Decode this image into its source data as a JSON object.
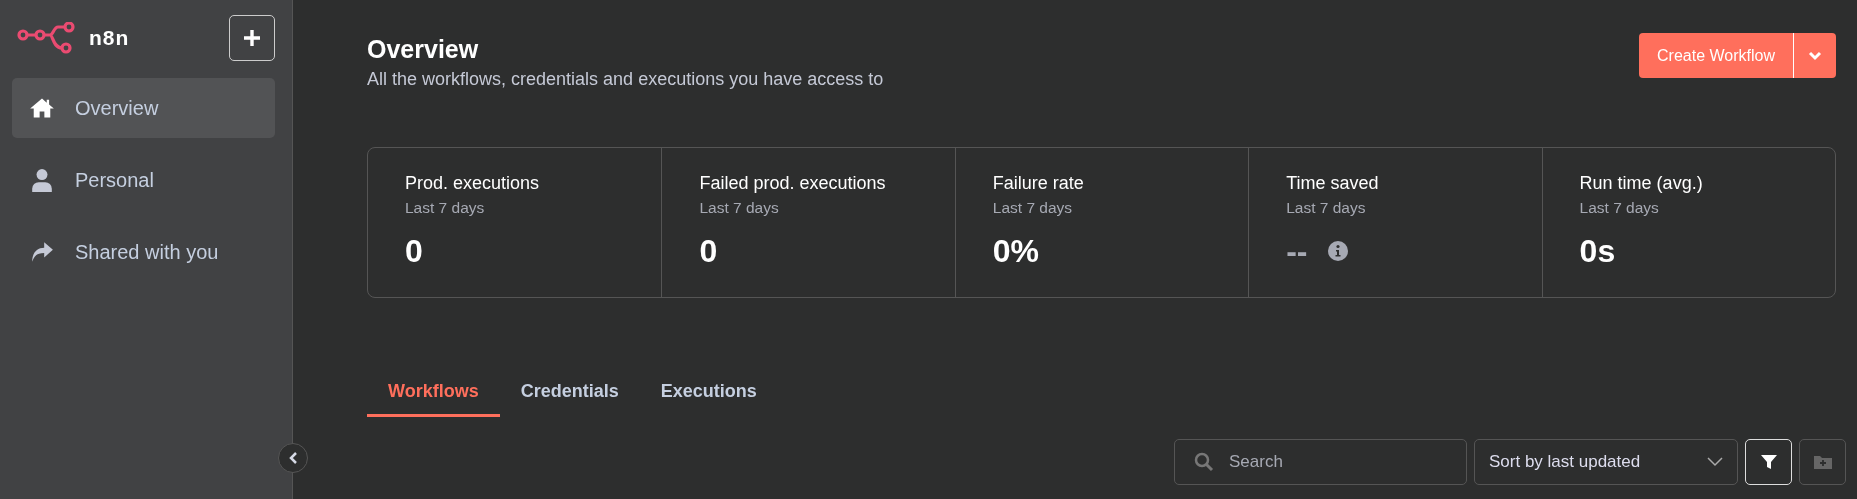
{
  "sidebar": {
    "logo_text": "n8n",
    "items": [
      {
        "label": "Overview",
        "selected": true
      },
      {
        "label": "Personal",
        "selected": false
      },
      {
        "label": "Shared with you",
        "selected": false
      }
    ]
  },
  "header": {
    "title": "Overview",
    "subtitle": "All the workflows, credentials and executions you have access to",
    "create_button": "Create Workflow"
  },
  "stats": [
    {
      "title": "Prod. executions",
      "period": "Last 7 days",
      "value": "0",
      "muted": false,
      "info": false
    },
    {
      "title": "Failed prod. executions",
      "period": "Last 7 days",
      "value": "0",
      "muted": false,
      "info": false
    },
    {
      "title": "Failure rate",
      "period": "Last 7 days",
      "value": "0%",
      "muted": false,
      "info": false
    },
    {
      "title": "Time saved",
      "period": "Last 7 days",
      "value": "--",
      "muted": true,
      "info": true
    },
    {
      "title": "Run time (avg.)",
      "period": "Last 7 days",
      "value": "0s",
      "muted": false,
      "info": false
    }
  ],
  "tabs": [
    {
      "label": "Workflows",
      "selected": true
    },
    {
      "label": "Credentials",
      "selected": false
    },
    {
      "label": "Executions",
      "selected": false
    }
  ],
  "toolbar": {
    "search": {
      "placeholder": "Search"
    },
    "sort": {
      "value": "Sort by last updated"
    },
    "icon_buttons": [
      {
        "kind": "filter",
        "disabled": false
      },
      {
        "kind": "new-folder",
        "disabled": true
      }
    ]
  }
}
